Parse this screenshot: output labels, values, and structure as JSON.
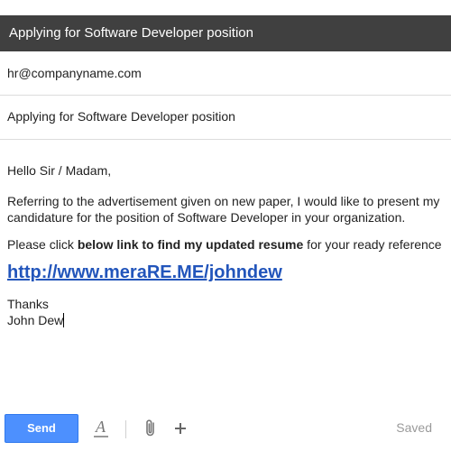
{
  "compose": {
    "title": "Applying for Software Developer position",
    "to": "hr@companyname.com",
    "subject": "Applying for Software Developer position"
  },
  "body": {
    "greeting": "Hello Sir / Madam,",
    "paragraph_line1": "Referring to the advertisement given on new paper, I would like to present my",
    "paragraph_line2": "candidature for the position of Software Developer in your organization.",
    "click_prefix": "Please click ",
    "click_bold": "below link to find my updated resume",
    "click_suffix": " for your ready reference",
    "link": "http://www.meraRE.ME/johndew",
    "thanks": "Thanks",
    "signature": "John Dew"
  },
  "toolbar": {
    "send_label": "Send",
    "format_icon": "format-text-icon",
    "attach_icon": "paperclip-icon",
    "insert_icon": "plus-icon",
    "status": "Saved"
  },
  "colors": {
    "titlebar": "#404040",
    "send": "#4d90fe",
    "link": "#2255bb"
  }
}
